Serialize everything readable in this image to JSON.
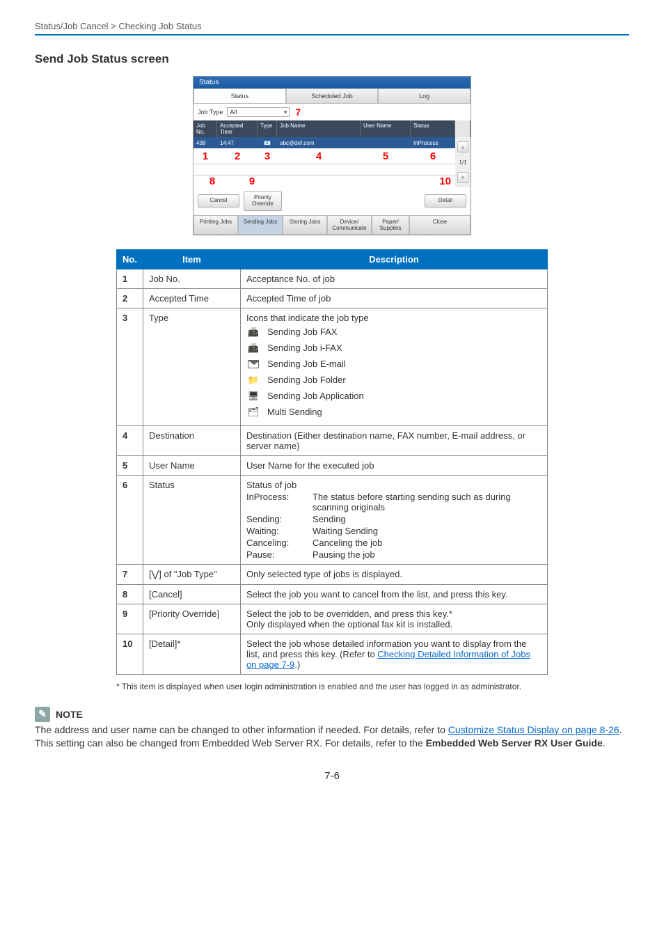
{
  "breadcrumb": "Status/Job Cancel > Checking Job Status",
  "section_title": "Send Job Status screen",
  "screenshot": {
    "title": "Status",
    "tabs": {
      "status": "Status",
      "scheduled": "Scheduled Job",
      "log": "Log"
    },
    "jobtype_label": "Job Type",
    "jobtype_value": "All",
    "headers": {
      "jobno": "Job No.",
      "accepted": "Accepted Time",
      "type": "Type",
      "jobname": "Job Name",
      "user": "User Name",
      "status": "Status"
    },
    "row": {
      "jobno": "438",
      "time": "14:47",
      "jobname": "abc@def.com",
      "user": "",
      "status": "InProcess"
    },
    "pager": "1/1",
    "callouts": {
      "c1": "1",
      "c2": "2",
      "c3": "3",
      "c4": "4",
      "c5": "5",
      "c6": "6",
      "c7": "7",
      "c8": "8",
      "c9": "9",
      "c10": "10"
    },
    "buttons": {
      "cancel": "Cancel",
      "priority": "Priority\nOverride",
      "detail": "Detail"
    },
    "bottom_tabs": {
      "printing": "Printing Jobs",
      "sending": "Sending Jobs",
      "storing": "Storing Jobs",
      "device": "Device/\nCommunicate",
      "paper": "Paper/\nSupplies",
      "close": "Close"
    }
  },
  "table": {
    "head": {
      "no": "No.",
      "item": "Item",
      "desc": "Description"
    },
    "r1": {
      "no": "1",
      "item": "Job No.",
      "desc": "Acceptance No. of job"
    },
    "r2": {
      "no": "2",
      "item": "Accepted Time",
      "desc": "Accepted Time of job"
    },
    "r3": {
      "no": "3",
      "item": "Type",
      "intro": "Icons that indicate the job type",
      "i1": "Sending Job FAX",
      "i2": "Sending Job i-FAX",
      "i3": "Sending Job E-mail",
      "i4": "Sending Job Folder",
      "i5": "Sending Job Application",
      "i6": "Multi Sending"
    },
    "r4": {
      "no": "4",
      "item": "Destination",
      "desc": "Destination (Either destination name, FAX number, E-mail address, or server name)"
    },
    "r5": {
      "no": "5",
      "item": "User Name",
      "desc": "User Name for the executed job"
    },
    "r6": {
      "no": "6",
      "item": "Status",
      "intro": "Status of job",
      "s1k": "InProcess:",
      "s1v": "The status before starting sending such as during scanning originals",
      "s2k": "Sending:",
      "s2v": "Sending",
      "s3k": "Waiting:",
      "s3v": "Waiting Sending",
      "s4k": "Canceling:",
      "s4v": "Canceling the job",
      "s5k": "Pause:",
      "s5v": "Pausing the job"
    },
    "r7": {
      "no": "7",
      "item": "[⋁] of \"Job Type\"",
      "desc": "Only selected type of jobs is displayed."
    },
    "r8": {
      "no": "8",
      "item": "[Cancel]",
      "desc": "Select the job you want to cancel from the list, and press this key."
    },
    "r9": {
      "no": "9",
      "item": "[Priority Override]",
      "l1": "Select the job to be overridden, and press this key.*",
      "l2": "Only displayed when the optional fax kit is installed."
    },
    "r10": {
      "no": "10",
      "item": "[Detail]*",
      "pre": "Select the job whose detailed information you want to display from the list, and press this key. (Refer to ",
      "link": "Checking Detailed Information of Jobs on page 7-9",
      "post": ".)"
    }
  },
  "footnote": "*   This item is displayed when user login administration is enabled and the user has logged in as administrator.",
  "note": {
    "label": "NOTE",
    "pre": "The address and user name can be changed to other information if needed. For details, refer to ",
    "link1": "Customize Status Display on page 8-26",
    "mid": ". This setting can also be changed from Embedded Web Server RX. For details, refer to the ",
    "bold": "Embedded Web Server RX User Guide",
    "post": "."
  },
  "page_number": "7-6"
}
